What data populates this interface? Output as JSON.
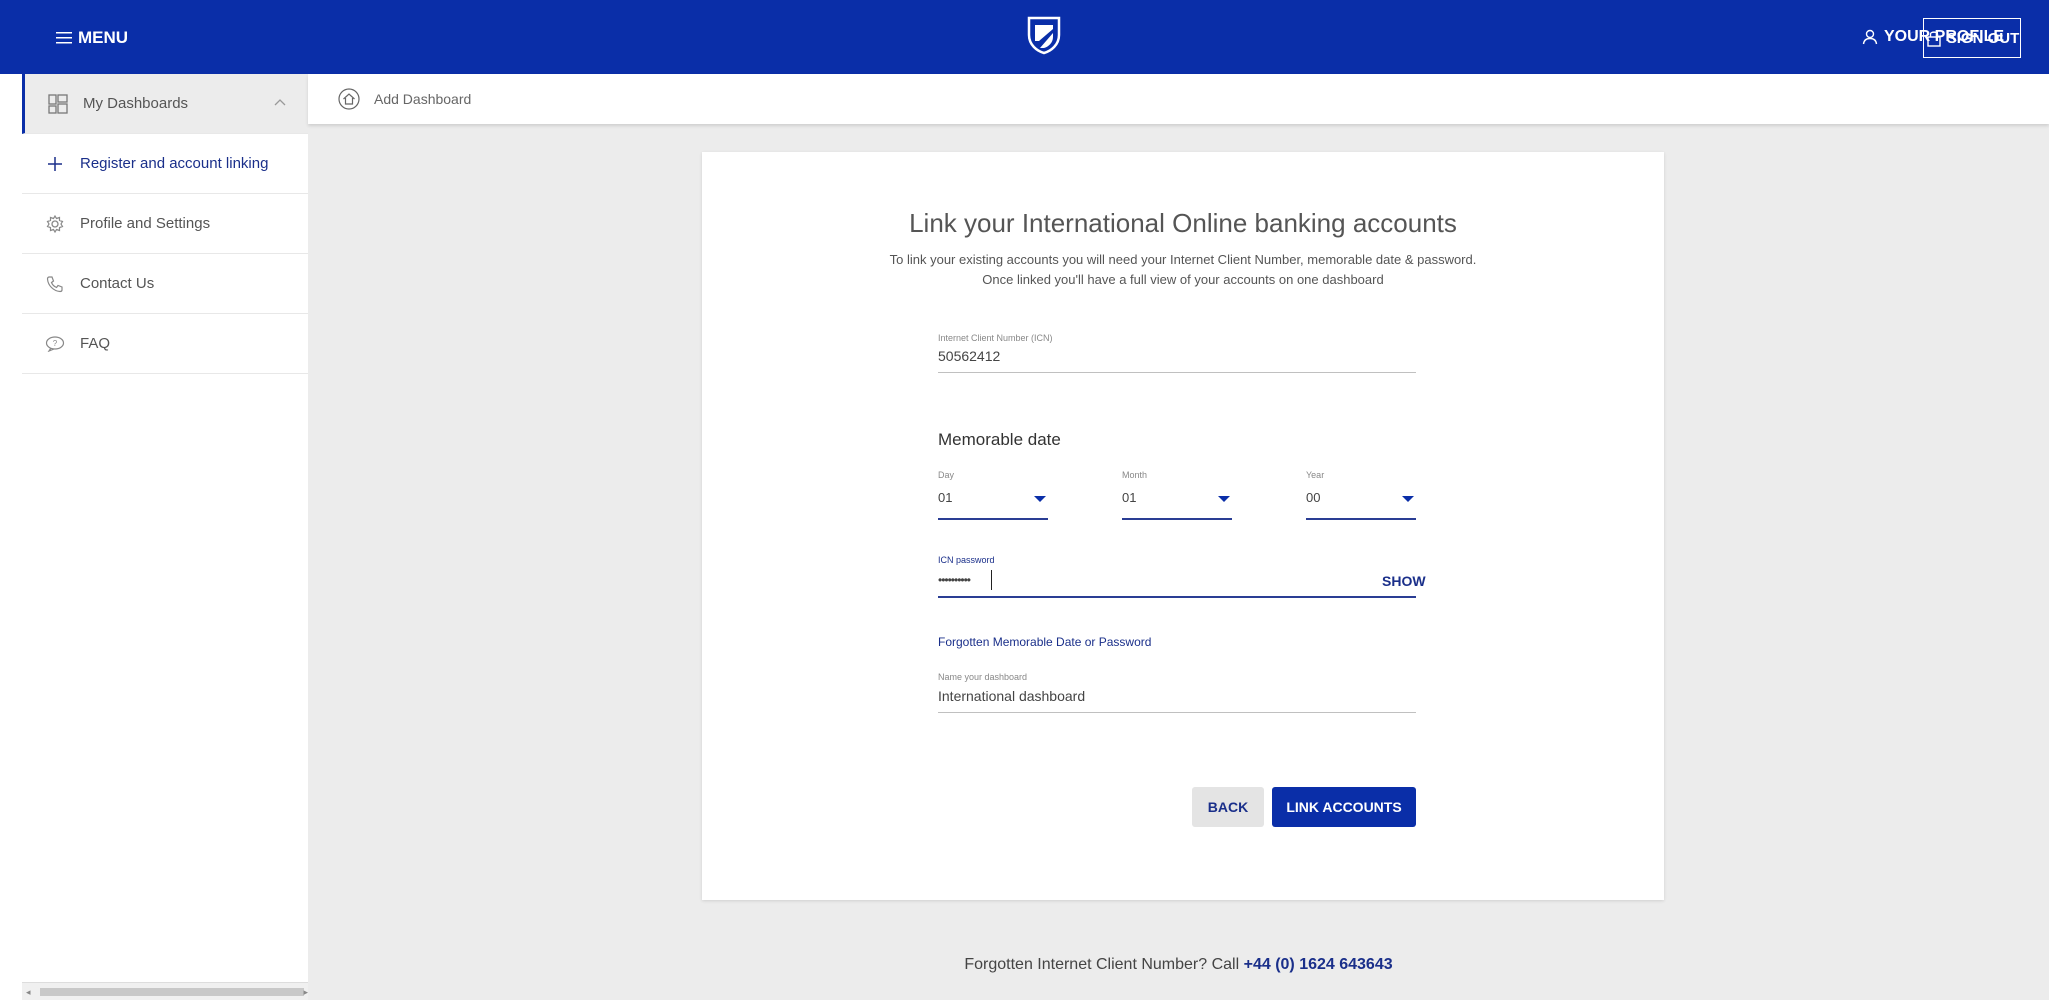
{
  "header": {
    "menu_label": "MENU",
    "profile_label": "YOUR PROFILE",
    "signout_label": "SIGN OUT"
  },
  "sidebar": {
    "items": [
      {
        "label": "My Dashboards",
        "icon": "dashboard-icon"
      },
      {
        "label": "Register and account linking",
        "icon": "plus-icon"
      },
      {
        "label": "Profile and Settings",
        "icon": "gear-icon"
      },
      {
        "label": "Contact Us",
        "icon": "phone-icon"
      },
      {
        "label": "FAQ",
        "icon": "faq-icon"
      }
    ]
  },
  "subbar": {
    "add_dashboard_label": "Add Dashboard"
  },
  "form": {
    "title": "Link your International Online banking accounts",
    "subtitle_line1": "To link your existing accounts you will need your Internet Client Number, memorable date & password.",
    "subtitle_line2": "Once linked you'll have a full view of your accounts on one dashboard",
    "icn": {
      "label": "Internet Client Number (ICN)",
      "value": "50562412"
    },
    "memorable_date": {
      "title": "Memorable date",
      "day": {
        "label": "Day",
        "value": "01"
      },
      "month": {
        "label": "Month",
        "value": "01"
      },
      "year": {
        "label": "Year",
        "value": "00"
      }
    },
    "password": {
      "label": "ICN password",
      "value": "••••••••••",
      "show_label": "SHOW"
    },
    "forgot_link": "Forgotten Memorable Date or Password",
    "dashboard_name": {
      "label": "Name your dashboard",
      "value": "International dashboard"
    },
    "back_label": "BACK",
    "link_label": "LINK ACCOUNTS"
  },
  "footer": {
    "text": "Forgotten Internet Client Number? Call",
    "phone": "+44 (0) 1624 643643"
  },
  "colors": {
    "brand_blue": "#0a2ea8",
    "link_blue": "#1a2f8a",
    "background_grey": "#ececec"
  }
}
